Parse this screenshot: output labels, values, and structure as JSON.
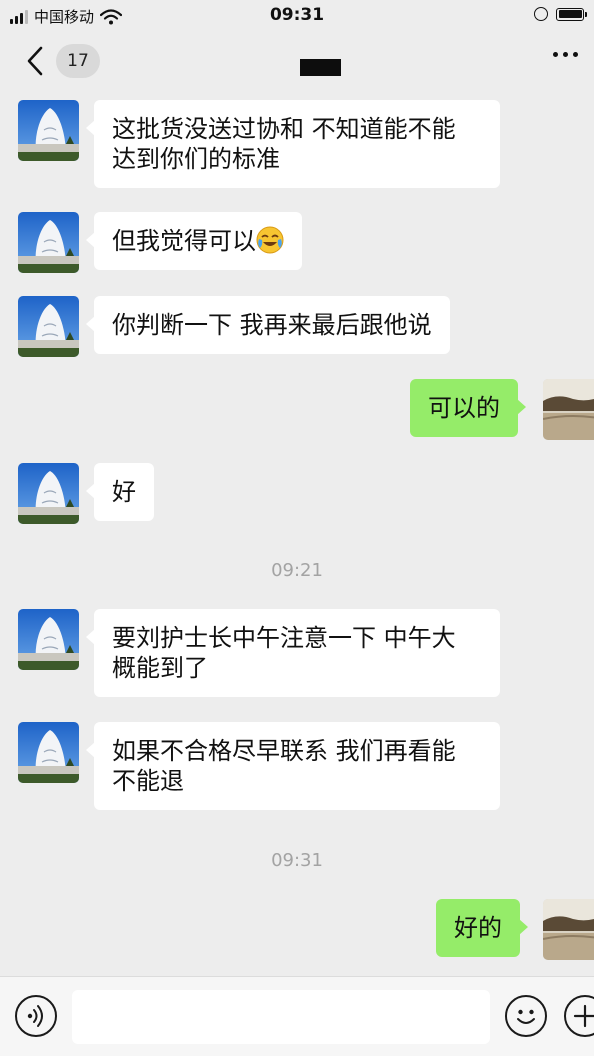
{
  "status_bar": {
    "carrier": "中国移动",
    "time": "09:31"
  },
  "header": {
    "back_label": "17",
    "title": ""
  },
  "messages": [
    {
      "side": "left",
      "text_lines": [
        "这批货没送过协和 不知道能不能",
        "达到你们的标准"
      ]
    },
    {
      "side": "left",
      "text": "但我觉得可以",
      "emoji": "face-with-tears-of-joy"
    },
    {
      "side": "left",
      "text": "你判断一下 我再来最后跟他说"
    },
    {
      "side": "right",
      "text": "可以的"
    },
    {
      "side": "left",
      "text": "好"
    },
    {
      "timestamp": "09:21"
    },
    {
      "side": "left",
      "text_lines": [
        "要刘护士长中午注意一下 中午大",
        "概能到了"
      ]
    },
    {
      "side": "left",
      "text_lines": [
        "如果不合格尽早联系 我们再看能",
        "不能退"
      ]
    },
    {
      "timestamp": "09:31"
    },
    {
      "side": "right",
      "text": "好的"
    }
  ],
  "input_bar": {
    "value": "",
    "icons": [
      "voice-icon",
      "emoji-icon",
      "plus-icon"
    ]
  },
  "colors": {
    "background": "#ededed",
    "bubble_self": "#95ec69",
    "bubble_other": "#ffffff",
    "timestamp": "#a3a3a3"
  }
}
